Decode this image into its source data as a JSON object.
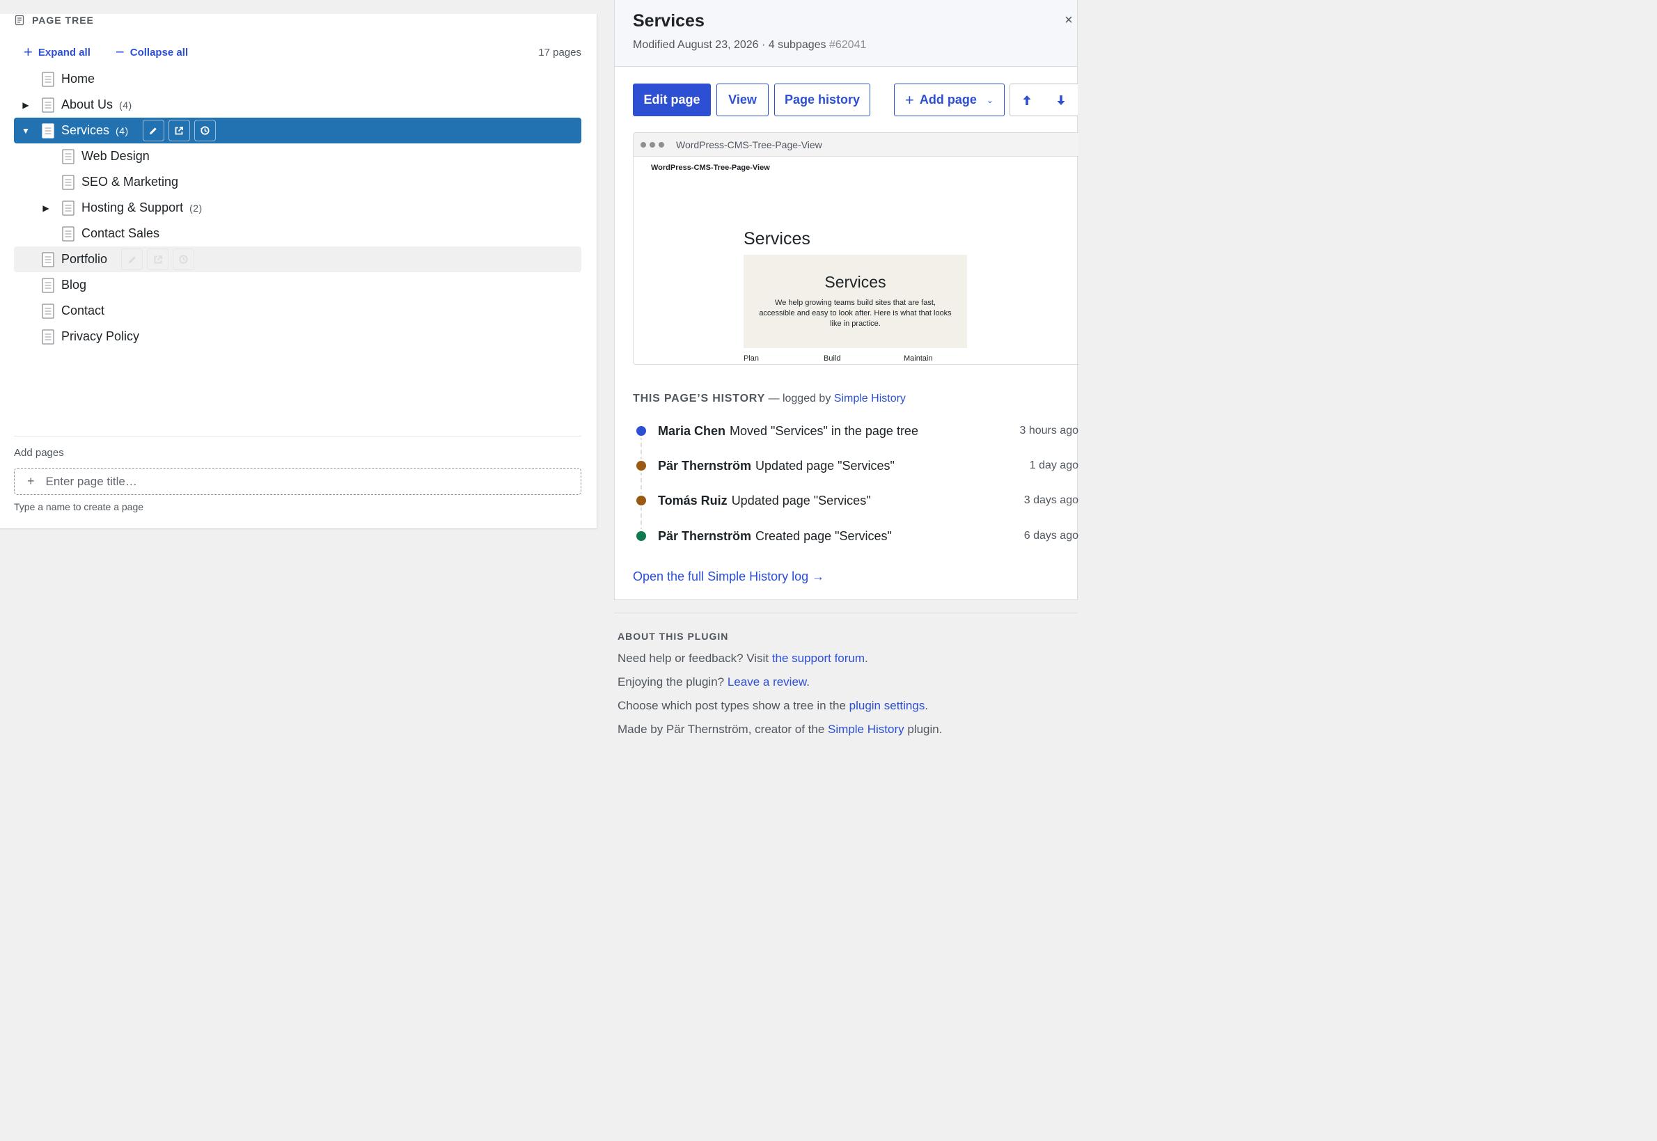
{
  "page_tree": {
    "title": "PAGE TREE",
    "expand_all": "Expand all",
    "collapse_all": "Collapse all",
    "page_count": "17 pages",
    "rows": [
      {
        "label": "Home",
        "count": ""
      },
      {
        "label": "About Us",
        "count": "(4)"
      },
      {
        "label": "Services",
        "count": "(4)"
      },
      {
        "label": "Web Design",
        "count": ""
      },
      {
        "label": "SEO & Marketing",
        "count": ""
      },
      {
        "label": "Hosting & Support",
        "count": "(2)"
      },
      {
        "label": "Contact Sales",
        "count": ""
      },
      {
        "label": "Portfolio",
        "count": ""
      },
      {
        "label": "Blog",
        "count": ""
      },
      {
        "label": "Contact",
        "count": ""
      },
      {
        "label": "Privacy Policy",
        "count": ""
      }
    ],
    "add_pages_label": "Add pages",
    "add_placeholder": "Enter page title…",
    "add_plus": "+",
    "add_hint": "Type a name to create a page"
  },
  "details": {
    "title": "Services",
    "modified": "Modified August 23, 2026 · 4 subpages",
    "page_id": "#62041",
    "close": "×",
    "buttons": {
      "edit": "Edit page",
      "view": "View",
      "history": "Page history",
      "add": "Add page"
    },
    "preview": {
      "url": "WordPress-CMS-Tree-Page-View",
      "site_name": "WordPress-CMS-Tree-Page-View",
      "heading": "Services",
      "card_title": "Services",
      "card_text": "We help growing teams build sites that are fast, accessible and easy to look after. Here is what that looks like in practice.",
      "columns": [
        "Plan",
        "Build",
        "Maintain"
      ]
    },
    "history": {
      "title_caps": "THIS PAGE’S HISTORY",
      "title_rest": " — logged by ",
      "title_link": "Simple History",
      "items": [
        {
          "user": "Maria Chen",
          "action": "Moved \"Services\" in the page tree",
          "time": "3 hours ago",
          "color": "#2c4fd4"
        },
        {
          "user": "Pär Thernström",
          "action": "Updated page \"Services\"",
          "time": "1 day ago",
          "color": "#9a5a14"
        },
        {
          "user": "Tomás Ruiz",
          "action": "Updated page \"Services\"",
          "time": "3 days ago",
          "color": "#9a5a14"
        },
        {
          "user": "Pär Thernström",
          "action": "Created page \"Services\"",
          "time": "6 days ago",
          "color": "#107a4f"
        }
      ],
      "full_log_link": "Open the full Simple History log →"
    }
  },
  "about": {
    "title": "ABOUT THIS PLUGIN",
    "l1_text": "Need help or feedback? Visit ",
    "l1_link": "the support forum",
    "l1_end": ".",
    "l2_text": "Enjoying the plugin? ",
    "l2_link": "Leave a review",
    "l2_end": ".",
    "l3_text": "Choose which post types show a tree in the ",
    "l3_link": "plugin settings",
    "l3_end": ".",
    "l4_text": "Made by Pär Thernström, creator of the ",
    "l4_link": "Simple History",
    "l4_end": " plugin."
  },
  "colors": {
    "accent": "#2c4fd4",
    "selected_row": "#2271b1"
  }
}
